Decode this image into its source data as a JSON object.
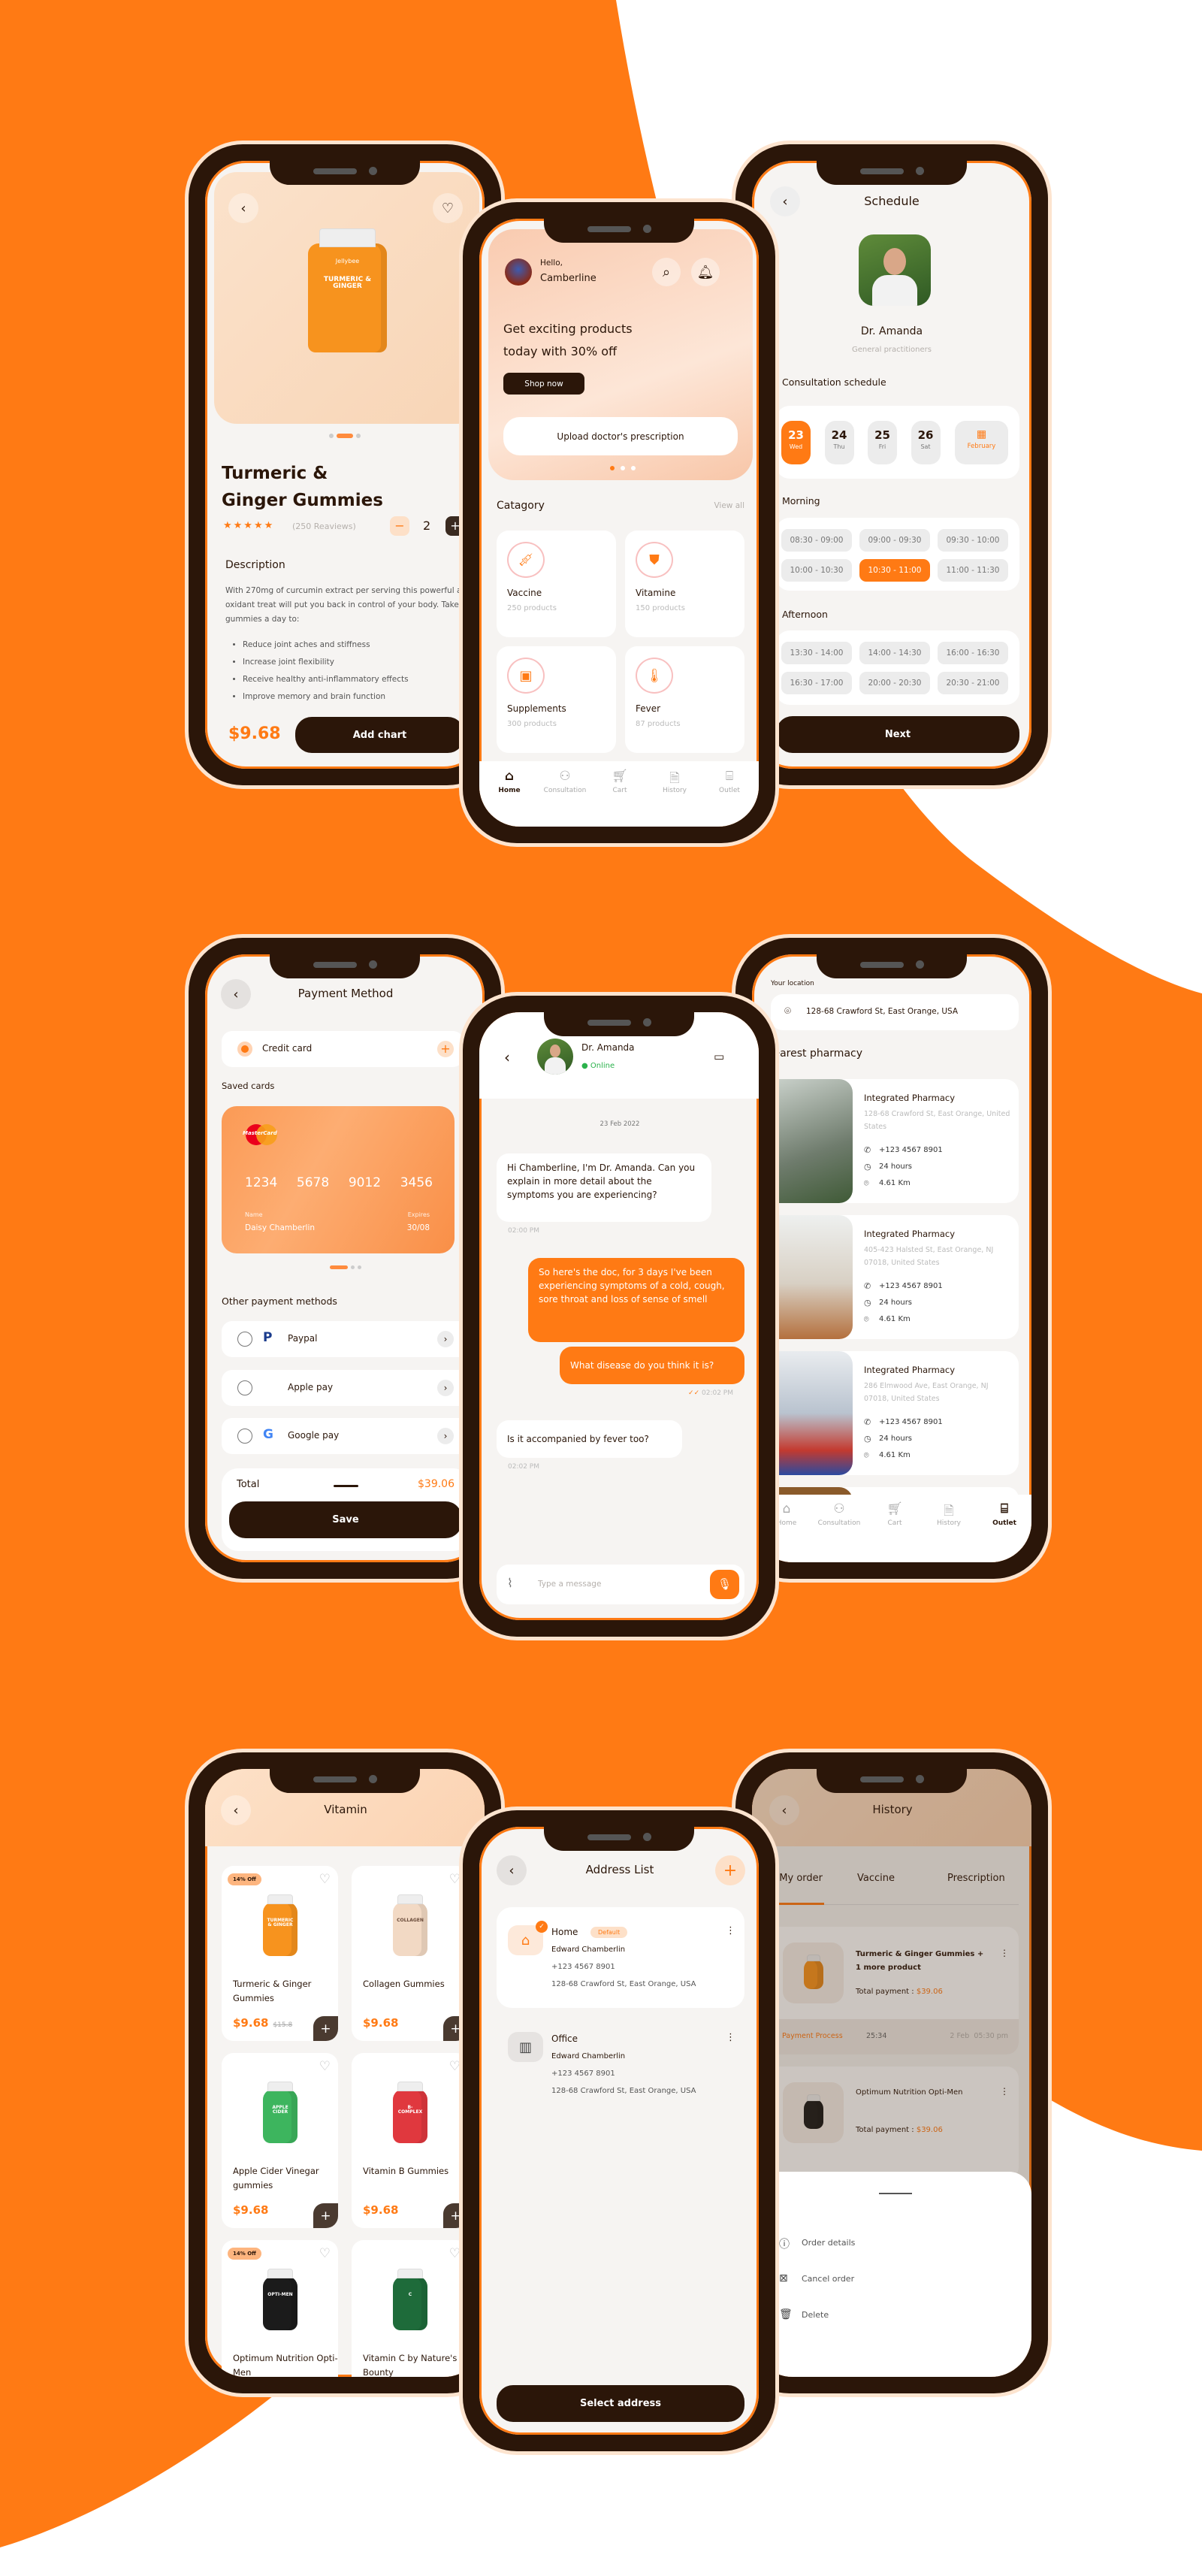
{
  "colors": {
    "accent": "#FF7A14",
    "dark": "#2B1609",
    "background": "#F6F4F2",
    "peach": "#FBD9C0"
  },
  "product": {
    "title_line1": "Turmeric &",
    "title_line2": "Ginger Gummies",
    "rating": 5,
    "reviews": "(250 Reaviews)",
    "quantity": "2",
    "minus": "−",
    "plus": "+",
    "description_heading": "Description",
    "description": "With 270mg of curcumin extract per serving this powerful anti-oxidant treat will put you back in control of your body. Take 2 gummies a day to:",
    "bullets": [
      "Reduce joint aches and stiffness",
      "Increase joint flexibility",
      "Receive healthy anti-inflammatory effects",
      "Improve memory and brain function"
    ],
    "price": "$9.68",
    "add_button": "Add chart",
    "bottle_brand": "Jellybee",
    "bottle_label": "TURMERIC & GINGER",
    "image_page": 2,
    "image_pages": 3
  },
  "home": {
    "greeting": "Hello,",
    "user": "Camberline",
    "banner_line1": "Get exciting products",
    "banner_line2": "today with 30% off",
    "shop_button": "Shop now",
    "upload_button": "Upload doctor's prescription",
    "category_heading": "Catagory",
    "view_all": "View all",
    "categories": [
      {
        "name": "Vaccine",
        "count": "250 products",
        "icon": "syringe-icon"
      },
      {
        "name": "Vitamine",
        "count": "150 products",
        "icon": "vitamin-bottle-icon"
      },
      {
        "name": "Supplements",
        "count": "300 products",
        "icon": "supplement-jar-icon"
      },
      {
        "name": "Fever",
        "count": "87 products",
        "icon": "thermometer-icon"
      }
    ]
  },
  "nav": {
    "items": [
      {
        "label": "Home",
        "icon": "home-icon"
      },
      {
        "label": "Consultation",
        "icon": "consultation-icon"
      },
      {
        "label": "Cart",
        "icon": "cart-icon"
      },
      {
        "label": "History",
        "icon": "history-icon"
      },
      {
        "label": "Outlet",
        "icon": "outlet-icon"
      }
    ]
  },
  "schedule": {
    "title": "Schedule",
    "doctor": "Dr. Amanda",
    "specialty": "General practitioners",
    "consultation_heading": "Consultation schedule",
    "dates": [
      {
        "day": "23",
        "weekday": "Wed",
        "selected": true
      },
      {
        "day": "24",
        "weekday": "Thu"
      },
      {
        "day": "25",
        "weekday": "Fri"
      },
      {
        "day": "26",
        "weekday": "Sat"
      }
    ],
    "month": "February",
    "morning_heading": "Morning",
    "morning_slots": [
      "08:30 - 09:00",
      "09:00 - 09:30",
      "09:30 - 10:00",
      "10:00 - 10:30",
      "10:30 - 11:00",
      "11:00 - 11:30"
    ],
    "selected_slot": "10:30 - 11:00",
    "afternoon_heading": "Afternoon",
    "afternoon_slots": [
      "13:30 - 14:00",
      "14:00 - 14:30",
      "16:00 - 16:30",
      "16:30 - 17:00",
      "20:00 - 20:30",
      "20:30 - 21:00"
    ],
    "next_button": "Next"
  },
  "payment": {
    "title": "Payment Method",
    "credit_card": "Credit card",
    "saved_cards_heading": "Saved cards",
    "card_brand": "MasterCard",
    "card_number": [
      "1234",
      "5678",
      "9012",
      "3456"
    ],
    "name_label": "Name",
    "name": "Daisy Chamberlin",
    "expires_label": "Expires",
    "expires": "30/08",
    "other_heading": "Other payment methods",
    "methods": [
      {
        "label": "Paypal",
        "icon": "paypal-icon"
      },
      {
        "label": "Apple pay",
        "icon": "apple-icon"
      },
      {
        "label": "Google pay",
        "icon": "google-icon"
      }
    ],
    "total_label": "Total",
    "total": "$39.06",
    "save_button": "Save"
  },
  "chat": {
    "doctor": "Dr. Amanda",
    "status": "Online",
    "date": "23 Feb 2022",
    "messages": [
      {
        "from": "doctor",
        "text": "Hi Chamberline, I'm Dr. Amanda. Can you explain in more detail about the symptoms you are experiencing?",
        "time": "02:00 PM"
      },
      {
        "from": "me",
        "text": "So here's the doc, for 3 days I've been experiencing symptoms of a cold, cough, sore throat and loss of sense of smell"
      },
      {
        "from": "me",
        "text": "What disease do you think it is?",
        "time": "02:02 PM"
      },
      {
        "from": "doctor",
        "text": "Is it accompanied by fever too?",
        "time": "02:02 PM"
      }
    ],
    "input_placeholder": "Type a message"
  },
  "pharmacy": {
    "location_label": "Your location",
    "location": "128-68 Crawford St, East Orange, USA",
    "heading": "Nearest pharmacy",
    "items": [
      {
        "name": "Integrated Pharmacy",
        "address": "128-68 Crawford St, East Orange, United States",
        "phone": "+123 4567 8901",
        "hours": "24 hours",
        "distance": "4.61 Km"
      },
      {
        "name": "Integrated Pharmacy",
        "address": "405-423 Halsted St, East Orange, NJ 07018, United States",
        "phone": "+123 4567 8901",
        "hours": "24 hours",
        "distance": "4.61 Km"
      },
      {
        "name": "Integrated Pharmacy",
        "address": "286 Elmwood Ave, East Orange, NJ 07018, United States",
        "phone": "+123 4567 8901",
        "hours": "24 hours",
        "distance": "4.61 Km"
      }
    ]
  },
  "vitamin": {
    "title": "Vitamin",
    "products": [
      {
        "name": "Turmeric & Ginger Gummies",
        "price": "$9.68",
        "old_price": "$15.8",
        "badge": "14% Off",
        "color": "#F7931E",
        "label": "TURMERIC & GINGER"
      },
      {
        "name": "Collagen Gummies",
        "price": "$9.68",
        "color": "#F2D9C4",
        "label": "COLLAGEN"
      },
      {
        "name": "Apple Cider Vinegar gummies",
        "price": "$9.68",
        "color": "#3DB55E",
        "label": "APPLE CIDER"
      },
      {
        "name": "Vitamin B Gummies",
        "price": "$9.68",
        "color": "#E0383E",
        "label": "B-COMPLEX"
      },
      {
        "name": "Optimum Nutrition Opti-Men",
        "badge": "14% Off",
        "color": "#1B1B1B",
        "label": "OPTI-MEN"
      },
      {
        "name": "Vitamin C by Nature's Bounty",
        "color": "#1E6B3A",
        "label": "C"
      }
    ]
  },
  "address": {
    "title": "Address List",
    "default_badge": "Default",
    "select_button": "Select address",
    "items": [
      {
        "label": "Home",
        "name": "Edward Chamberlin",
        "phone": "+123 4567 8901",
        "address": "128-68 Crawford St, East Orange, USA",
        "icon": "home-icon",
        "selected": true
      },
      {
        "label": "Office",
        "name": "Edward Chamberlin",
        "phone": "+123 4567 8901",
        "address": "128-68 Crawford St, East Orange, USA",
        "icon": "building-icon"
      }
    ]
  },
  "history": {
    "title": "History",
    "tabs": [
      "My order",
      "Vaccine",
      "Prescription"
    ],
    "active_tab": "My order",
    "orders": [
      {
        "name": "Turmeric & Ginger Gummies + 1 more product",
        "total_label": "Total payment :",
        "total": "$39.06",
        "status": "Payment Process",
        "timer": "25:34",
        "date": "2 Feb",
        "time": "05:30 pm"
      },
      {
        "name": "Optimum Nutrition Opti-Men",
        "total_label": "Total payment :",
        "total": "$39.06"
      }
    ],
    "sheet_actions": [
      {
        "label": "Order details",
        "icon": "info-icon"
      },
      {
        "label": "Cancel order",
        "icon": "cancel-bag-icon"
      },
      {
        "label": "Delete",
        "icon": "trash-icon"
      }
    ]
  }
}
